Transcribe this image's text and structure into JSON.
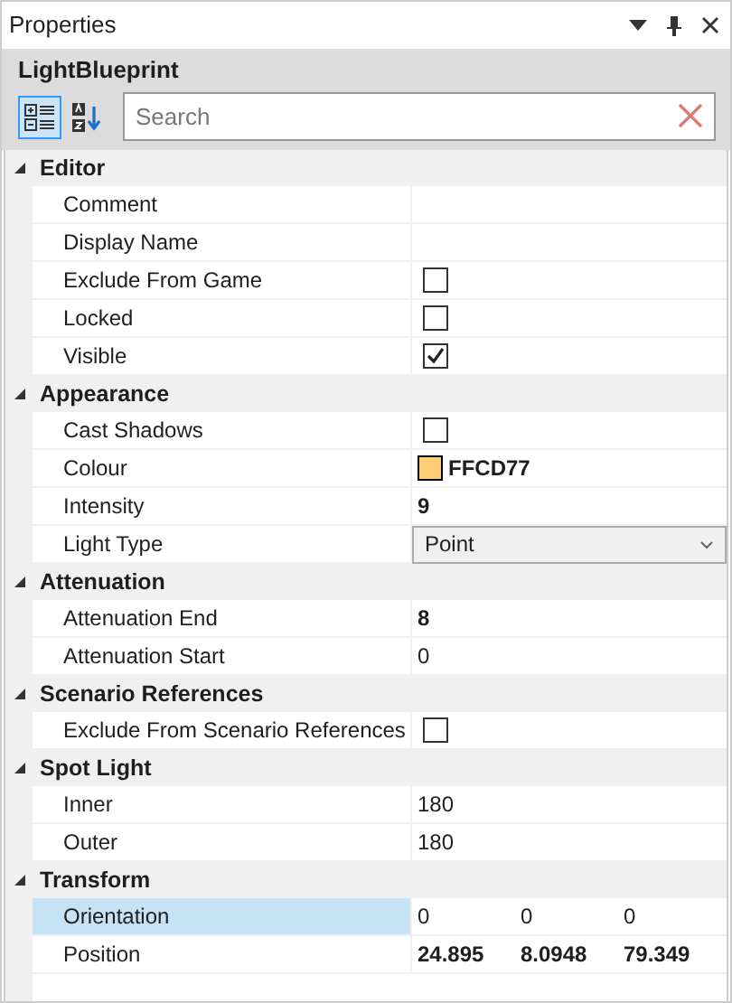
{
  "panel": {
    "title": "Properties",
    "object_name": "LightBlueprint"
  },
  "toolbar": {
    "categorized_selected": true,
    "alphabetical_selected": false,
    "search": {
      "placeholder": "Search"
    }
  },
  "categories": [
    {
      "name": "Editor",
      "expanded": true,
      "properties": [
        {
          "name": "Comment",
          "kind": "text",
          "selected": false
        },
        {
          "name": "Display Name",
          "kind": "text",
          "selected": false
        },
        {
          "name": "Exclude From Game",
          "kind": "checkbox",
          "checked": false,
          "selected": false
        },
        {
          "name": "Locked",
          "kind": "checkbox",
          "checked": false,
          "selected": false
        },
        {
          "name": "Visible",
          "kind": "checkbox",
          "checked": true,
          "selected": false
        }
      ]
    },
    {
      "name": "Appearance",
      "expanded": true,
      "properties": [
        {
          "name": "Cast Shadows",
          "kind": "checkbox",
          "checked": false,
          "selected": false
        },
        {
          "name": "Colour",
          "kind": "color",
          "value": "FFCD77",
          "color": "#ffcd77",
          "selected": false
        },
        {
          "name": "Intensity",
          "kind": "text",
          "value": "9",
          "bold": true,
          "selected": false
        },
        {
          "name": "Light Type",
          "kind": "dropdown",
          "value": "Point",
          "selected": false
        }
      ]
    },
    {
      "name": "Attenuation",
      "expanded": true,
      "properties": [
        {
          "name": "Attenuation End",
          "kind": "text",
          "value": "8",
          "bold": true,
          "selected": false
        },
        {
          "name": "Attenuation Start",
          "kind": "text",
          "value": "0",
          "bold": false,
          "selected": false
        }
      ]
    },
    {
      "name": "Scenario References",
      "expanded": true,
      "properties": [
        {
          "name": "Exclude From Scenario References",
          "kind": "checkbox",
          "checked": false,
          "selected": false
        }
      ]
    },
    {
      "name": "Spot Light",
      "expanded": true,
      "properties": [
        {
          "name": "Inner",
          "kind": "text",
          "value": "180",
          "bold": false,
          "selected": false
        },
        {
          "name": "Outer",
          "kind": "text",
          "value": "180",
          "bold": false,
          "selected": false
        }
      ]
    },
    {
      "name": "Transform",
      "expanded": true,
      "properties": [
        {
          "name": "Orientation",
          "kind": "vector",
          "values": [
            "0",
            "0",
            "0"
          ],
          "bold": false,
          "selected": true
        },
        {
          "name": "Position",
          "kind": "vector",
          "values": [
            "24.895",
            "8.0948",
            "79.349"
          ],
          "bold": true,
          "selected": false
        }
      ]
    }
  ]
}
